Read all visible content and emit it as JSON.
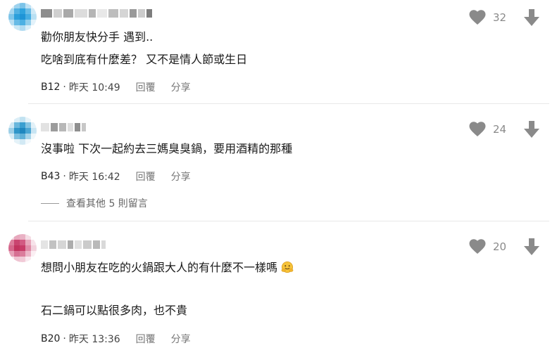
{
  "comments": [
    {
      "lines": [
        "勸你朋友快分手 遇到..",
        "吃啥到底有什麼差？ 又不是情人節或生日"
      ],
      "floor": "B12",
      "time": "昨天 10:49",
      "likes": "32"
    },
    {
      "lines": [
        "沒事啦 下次一起約去三媽臭臭鍋，要用酒精的那種"
      ],
      "floor": "B43",
      "time": "昨天 16:42",
      "likes": "24"
    },
    {
      "lines": [
        "想問小朋友在吃的火鍋跟大人的有什麼不一樣嗎",
        "石二鍋可以點很多肉，也不貴"
      ],
      "floor": "B20",
      "time": "昨天 13:36",
      "likes": "20"
    }
  ],
  "labels": {
    "reply": "回覆",
    "share": "分享",
    "dot": "·",
    "more_replies": "查看其他 5 則留言"
  },
  "icons": {
    "like": "heart-icon",
    "down": "arrow-down-icon",
    "emoji": "hugging-face-emoji"
  },
  "colors": {
    "icon_gray": "#8a8a8a",
    "divider": "#e8e8e8"
  }
}
